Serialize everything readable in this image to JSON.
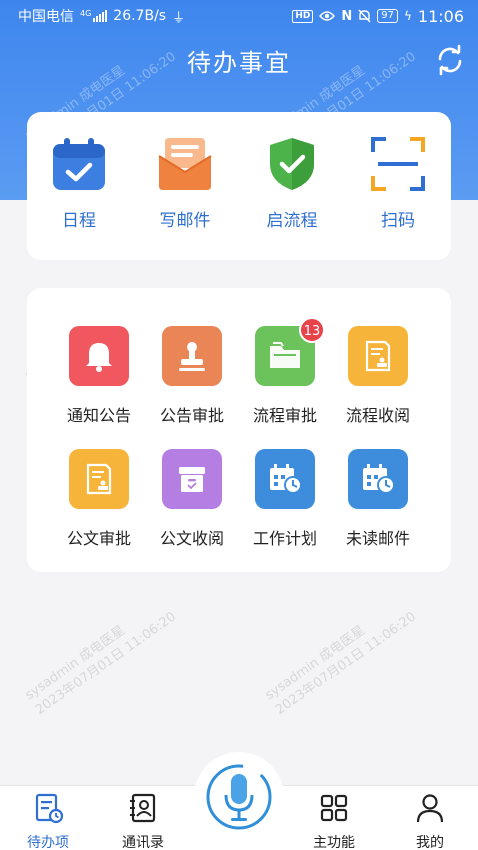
{
  "status_bar": {
    "carrier": "中国电信",
    "network_type": "4G",
    "speed": "26.7B/s",
    "hd_label": "HD",
    "battery": "97",
    "time": "11:06"
  },
  "header": {
    "title": "待办事宜"
  },
  "quick_actions": [
    {
      "label": "日程",
      "icon": "calendar-check-icon"
    },
    {
      "label": "写邮件",
      "icon": "envelope-letter-icon"
    },
    {
      "label": "启流程",
      "icon": "shield-check-icon"
    },
    {
      "label": "扫码",
      "icon": "scan-frame-icon"
    }
  ],
  "apps": [
    {
      "label": "通知公告",
      "icon": "bell-icon",
      "color": "#f0575f"
    },
    {
      "label": "公告审批",
      "icon": "stamp-icon",
      "color": "#ea8656"
    },
    {
      "label": "流程审批",
      "icon": "folder-icon",
      "color": "#6cc35b",
      "badge": "13"
    },
    {
      "label": "流程收阅",
      "icon": "document-stamp-icon",
      "color": "#f7b43a"
    },
    {
      "label": "公文审批",
      "icon": "document-stamp-icon",
      "color": "#f7b43a"
    },
    {
      "label": "公文收阅",
      "icon": "archive-box-icon",
      "color": "#b57ee3"
    },
    {
      "label": "工作计划",
      "icon": "calendar-clock-icon",
      "color": "#3d8ddc"
    },
    {
      "label": "未读邮件",
      "icon": "calendar-clock-icon",
      "color": "#3d8ddc"
    }
  ],
  "watermark": {
    "line1": "sysadmin 成电医星",
    "line2": "2023年07月01日 11:06:20"
  },
  "tabbar": {
    "tabs": [
      {
        "label": "待办项",
        "icon": "todo-list-icon",
        "active": true
      },
      {
        "label": "通讯录",
        "icon": "contacts-icon",
        "active": false
      },
      {
        "label": "主功能",
        "icon": "grid-apps-icon",
        "active": false
      },
      {
        "label": "我的",
        "icon": "person-icon",
        "active": false
      }
    ],
    "voice_icon": "microphone-icon"
  },
  "colors": {
    "accent": "#2f6fd1",
    "header_gradient_top": "#3e86ee",
    "badge": "#e8424b"
  }
}
